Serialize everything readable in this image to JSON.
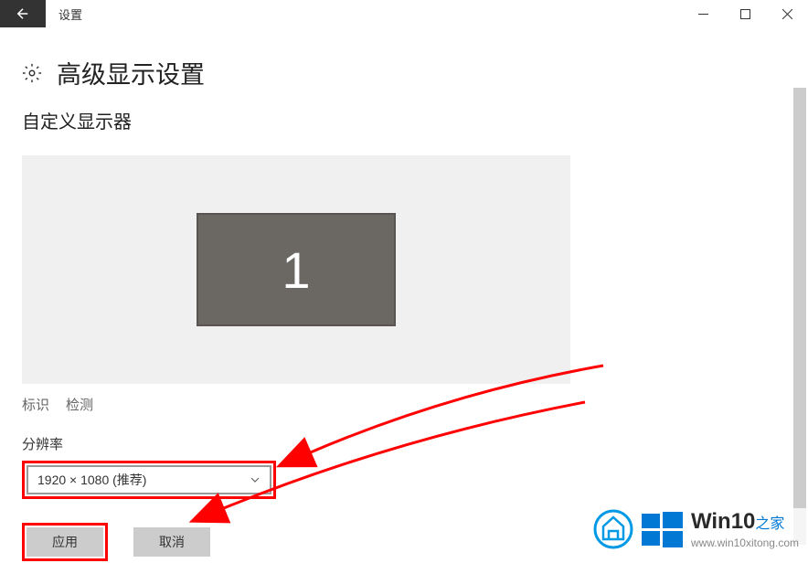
{
  "titlebar": {
    "app_name": "设置"
  },
  "header": {
    "page_title": "高级显示设置"
  },
  "section": {
    "custom_display": "自定义显示器",
    "monitor_number": "1",
    "identify": "标识",
    "detect": "检测",
    "resolution_label": "分辨率",
    "resolution_value": "1920 × 1080 (推荐)"
  },
  "buttons": {
    "apply": "应用",
    "cancel": "取消"
  },
  "watermark": {
    "brand": "Win10",
    "suffix": "之家",
    "url": "www.win10xitong.com"
  }
}
